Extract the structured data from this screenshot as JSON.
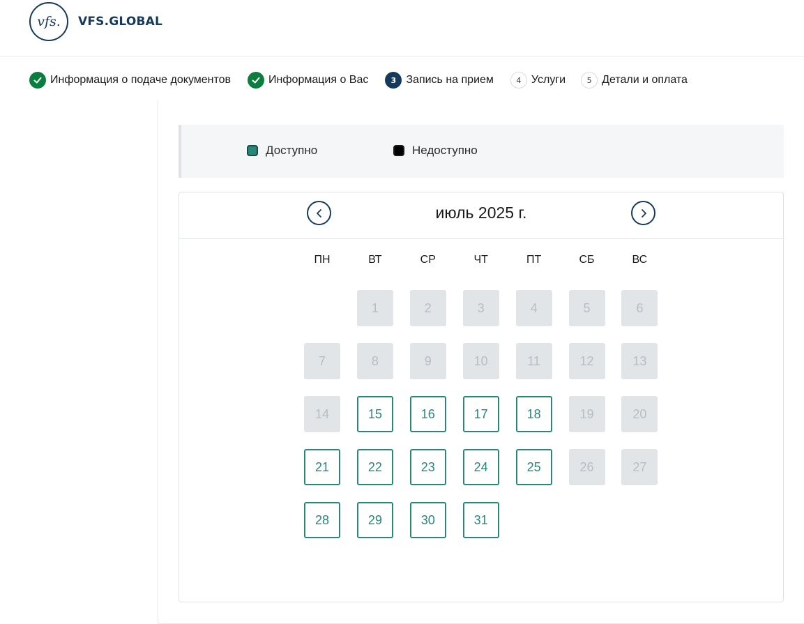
{
  "brand": {
    "logo_mark": "vfs.",
    "name": "VFS.GLOBAL"
  },
  "stepper": [
    {
      "status": "done",
      "number": "1",
      "label": "Информация о подаче документов"
    },
    {
      "status": "done",
      "number": "2",
      "label": "Информация о Вас"
    },
    {
      "status": "active",
      "number": "3",
      "label": "Запись на прием"
    },
    {
      "status": "pending",
      "number": "4",
      "label": "Услуги"
    },
    {
      "status": "pending",
      "number": "5",
      "label": "Детали и оплата"
    }
  ],
  "legend": {
    "available": "Доступно",
    "unavailable": "Недоступно"
  },
  "calendar": {
    "month_label": "июль 2025 г.",
    "weekdays": [
      "ПН",
      "ВТ",
      "СР",
      "ЧТ",
      "ПТ",
      "СБ",
      "ВС"
    ],
    "first_weekday_index": 1,
    "days": [
      {
        "n": "1",
        "status": "unavailable"
      },
      {
        "n": "2",
        "status": "unavailable"
      },
      {
        "n": "3",
        "status": "unavailable"
      },
      {
        "n": "4",
        "status": "unavailable"
      },
      {
        "n": "5",
        "status": "unavailable"
      },
      {
        "n": "6",
        "status": "unavailable"
      },
      {
        "n": "7",
        "status": "unavailable"
      },
      {
        "n": "8",
        "status": "unavailable"
      },
      {
        "n": "9",
        "status": "unavailable"
      },
      {
        "n": "10",
        "status": "unavailable"
      },
      {
        "n": "11",
        "status": "unavailable"
      },
      {
        "n": "12",
        "status": "unavailable"
      },
      {
        "n": "13",
        "status": "unavailable"
      },
      {
        "n": "14",
        "status": "unavailable"
      },
      {
        "n": "15",
        "status": "available"
      },
      {
        "n": "16",
        "status": "available"
      },
      {
        "n": "17",
        "status": "available"
      },
      {
        "n": "18",
        "status": "available"
      },
      {
        "n": "19",
        "status": "unavailable"
      },
      {
        "n": "20",
        "status": "unavailable"
      },
      {
        "n": "21",
        "status": "available"
      },
      {
        "n": "22",
        "status": "available"
      },
      {
        "n": "23",
        "status": "available"
      },
      {
        "n": "24",
        "status": "available"
      },
      {
        "n": "25",
        "status": "available"
      },
      {
        "n": "26",
        "status": "unavailable"
      },
      {
        "n": "27",
        "status": "unavailable"
      },
      {
        "n": "28",
        "status": "available"
      },
      {
        "n": "29",
        "status": "available"
      },
      {
        "n": "30",
        "status": "available"
      },
      {
        "n": "31",
        "status": "available"
      }
    ]
  },
  "colors": {
    "brand": "#153a5b",
    "done": "#0a7d3f",
    "available": "#27877a",
    "unavailable_bg": "#e2e5e8"
  }
}
